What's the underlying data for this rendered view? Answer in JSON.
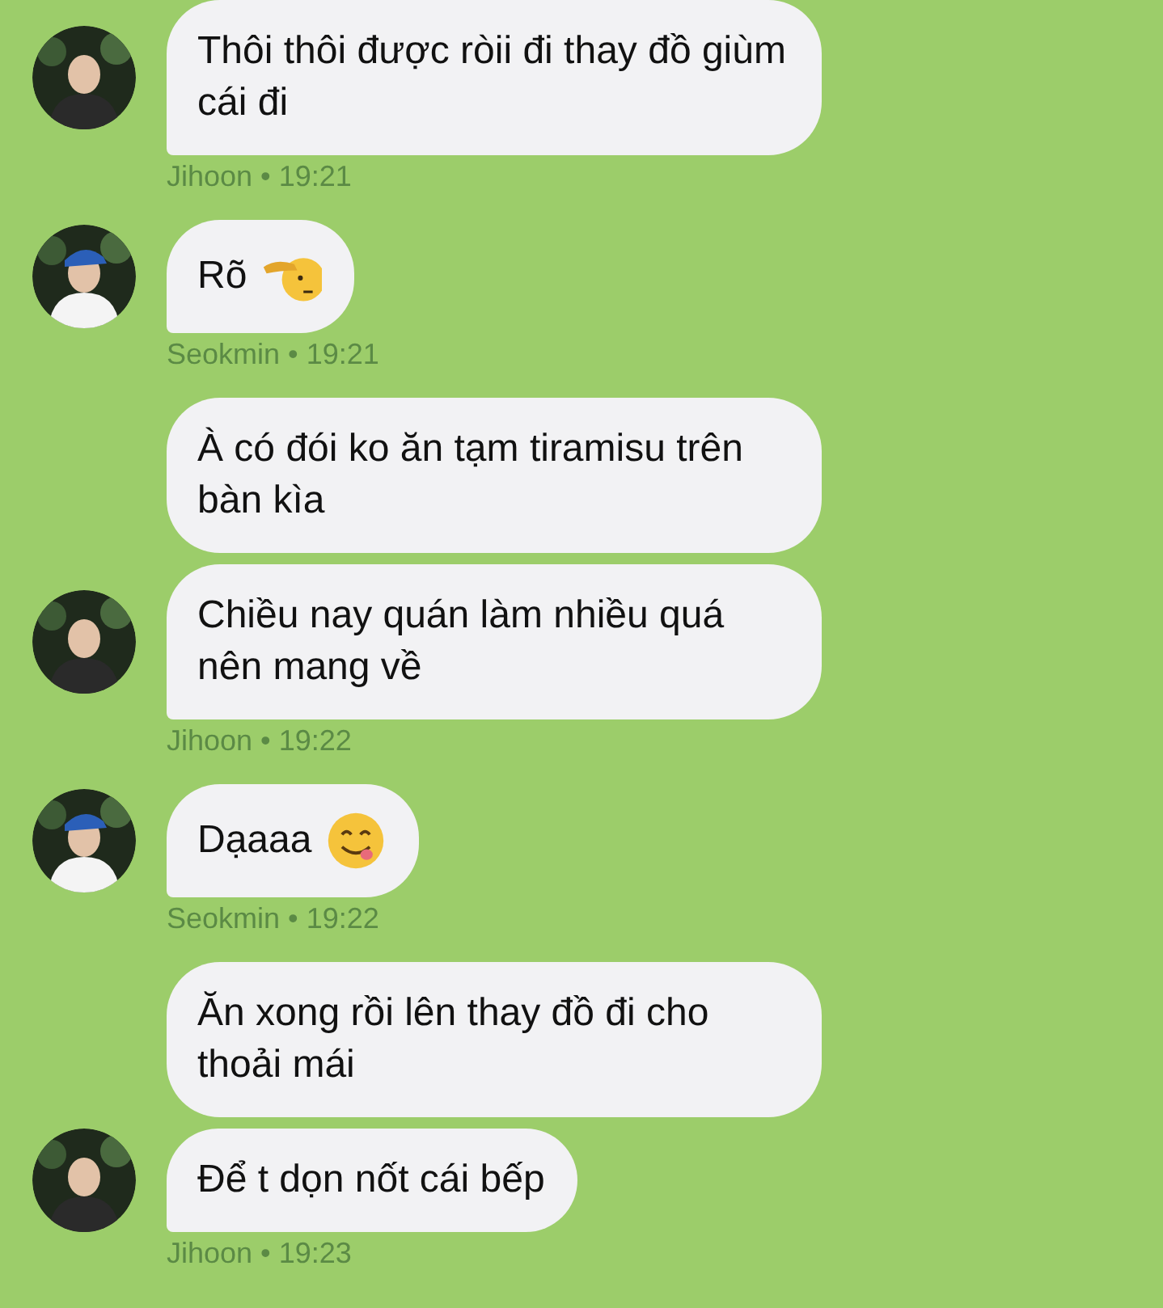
{
  "groups": [
    {
      "messages": [
        {
          "text": "Thôi thôi được ròii đi thay đồ giùm cái đi"
        }
      ],
      "meta": "Jihoon • 19:21",
      "avatar": {
        "kind": "picture"
      }
    },
    {
      "messages": [
        {
          "text": "Rõ",
          "kind": "salute"
        }
      ],
      "meta": "Seokmin • 19:21",
      "avatar": {
        "kind": "picture"
      }
    },
    {
      "messages": [
        {
          "text": "À có đói ko ăn tạm tiramisu trên bàn kìa"
        },
        {
          "text": "Chiều nay quán làm nhiều quá nên mang về"
        }
      ],
      "meta": "Jihoon • 19:22",
      "avatar": {
        "kind": "picture"
      }
    },
    {
      "messages": [
        {
          "text": "Dạaaa",
          "kind": "yum"
        }
      ],
      "meta": "Seokmin • 19:22",
      "avatar": {
        "kind": "picture"
      }
    },
    {
      "messages": [
        {
          "text": "Ăn xong rồi lên thay đồ đi cho thoải mái"
        },
        {
          "text": "Để t dọn nốt cái bếp"
        }
      ],
      "meta": "Jihoon • 19:23",
      "avatar": {
        "kind": "picture"
      }
    }
  ]
}
